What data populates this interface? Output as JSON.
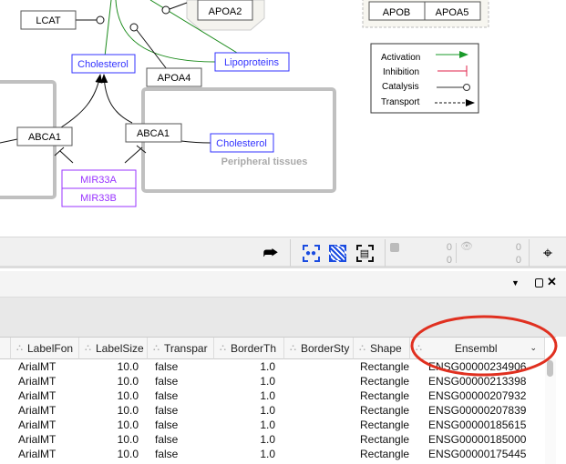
{
  "network": {
    "nodes": {
      "lcat": "LCAT",
      "apoa2": "APOA2",
      "apob": "APOB",
      "apoa5": "APOA5",
      "cholesterol_top": "Cholesterol",
      "lipoproteins": "Lipoproteins",
      "apoa4": "APOA4",
      "abca1_left": "ABCA1",
      "abca1_right": "ABCA1",
      "cholesterol_right": "Cholesterol",
      "mir33a": "MIR33A",
      "mir33b": "MIR33B"
    },
    "compartment_label": "Peripheral tissues",
    "legend": [
      {
        "label": "Activation",
        "color": "#1a9a2a"
      },
      {
        "label": "Inhibition",
        "color": "#e0204a"
      },
      {
        "label": "Catalysis",
        "color": "#333333"
      },
      {
        "label": "Transport",
        "color": "#111111"
      }
    ],
    "colors": {
      "metabolite": "#3333ff",
      "mirna": "#9933ff",
      "compartment": "#c0c0c0",
      "edge_activation": "#1a8a1a"
    }
  },
  "toolbar": {
    "selected_nodes": "0",
    "selected_edges": "0",
    "hidden_nodes": "0",
    "hidden_edges": "0"
  },
  "table": {
    "columns": [
      "LabelFon",
      "LabelSize",
      "Transpar",
      "BorderTh",
      "BorderSty",
      "Shape",
      "Ensembl"
    ],
    "rows": [
      [
        "ArialMT",
        "10.0",
        "false",
        "1.0",
        "",
        "Rectangle",
        "ENSG00000234906"
      ],
      [
        "ArialMT",
        "10.0",
        "false",
        "1.0",
        "",
        "Rectangle",
        "ENSG00000213398"
      ],
      [
        "ArialMT",
        "10.0",
        "false",
        "1.0",
        "",
        "Rectangle",
        "ENSG00000207932"
      ],
      [
        "ArialMT",
        "10.0",
        "false",
        "1.0",
        "",
        "Rectangle",
        "ENSG00000207839"
      ],
      [
        "ArialMT",
        "10.0",
        "false",
        "1.0",
        "",
        "Rectangle",
        "ENSG00000185615"
      ],
      [
        "ArialMT",
        "10.0",
        "false",
        "1.0",
        "",
        "Rectangle",
        "ENSG00000185000"
      ],
      [
        "ArialMT",
        "10.0",
        "false",
        "1.0",
        "",
        "Rectangle",
        "ENSG00000175445"
      ]
    ],
    "highlight_color": "#e03020"
  }
}
